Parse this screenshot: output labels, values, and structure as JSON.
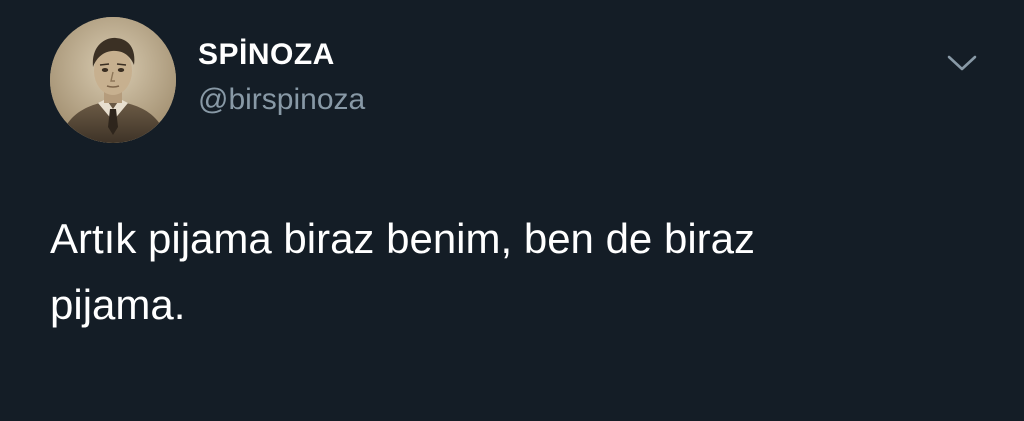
{
  "tweet": {
    "author": {
      "display_name": "SPİNOZA",
      "handle": "@birspinoza",
      "avatar": "sepia-portrait-avatar"
    },
    "menu_icon": "chevron-down-icon",
    "text_line_1": "Artık pijama biraz benim, ben de biraz",
    "text_line_2": "pijama."
  },
  "colors": {
    "background": "#141d26",
    "text_primary": "#ffffff",
    "text_secondary": "#8899a6",
    "icon": "#8899a6"
  }
}
